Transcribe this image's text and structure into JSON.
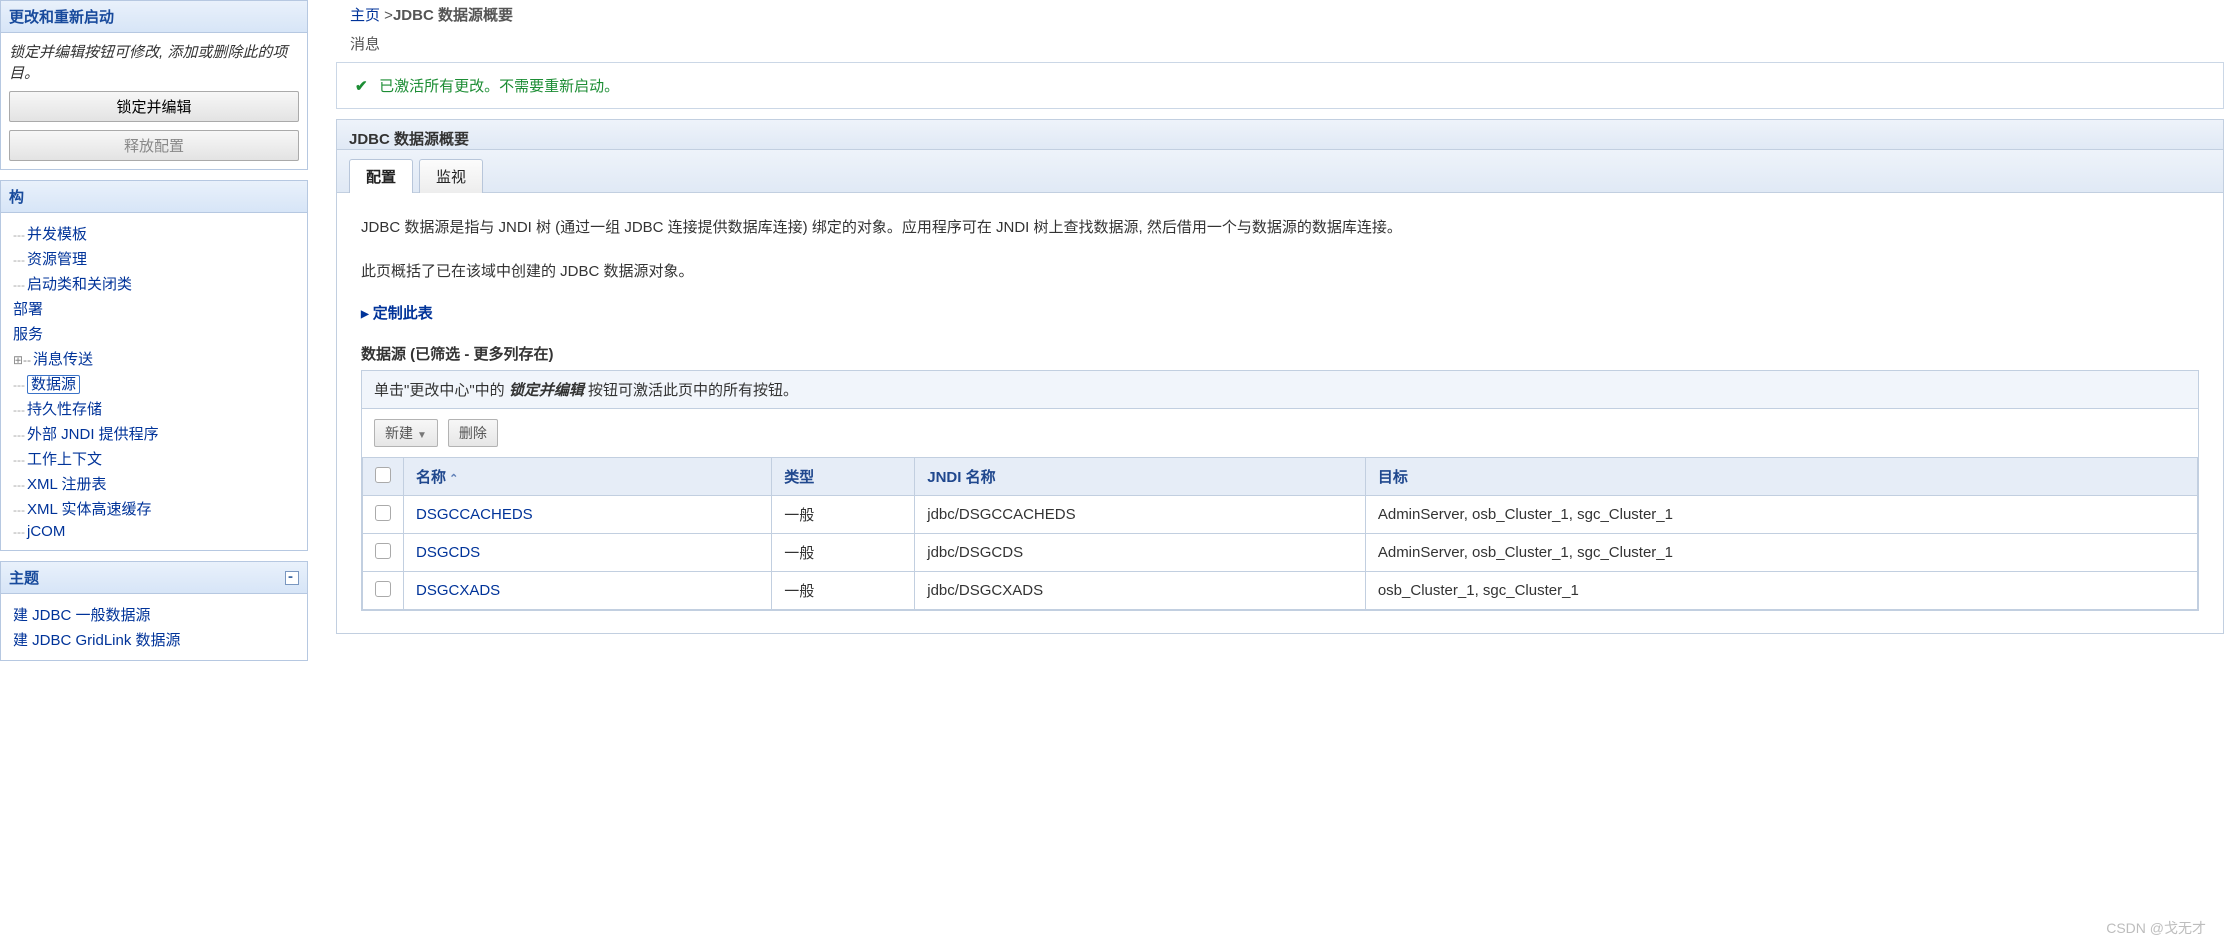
{
  "left": {
    "change_center": {
      "title": "更改和重新启动",
      "note": "锁定并编辑按钮可修改, 添加或删除此的项目。",
      "lock_btn": "锁定并编辑",
      "release_btn": "释放配置"
    },
    "domain_tree": {
      "title": "构",
      "items": [
        {
          "kind": "leaf",
          "label": "并发模板"
        },
        {
          "kind": "leaf",
          "label": "资源管理"
        },
        {
          "kind": "leaf",
          "label": "启动类和关闭类"
        },
        {
          "kind": "rootleaf",
          "label": "部署"
        },
        {
          "kind": "rootleaf",
          "label": "服务"
        },
        {
          "kind": "branch",
          "label": "消息传送"
        },
        {
          "kind": "leaf",
          "label": "数据源",
          "selected": true
        },
        {
          "kind": "leaf",
          "label": "持久性存储"
        },
        {
          "kind": "leaf",
          "label": "外部 JNDI 提供程序"
        },
        {
          "kind": "leaf",
          "label": "工作上下文"
        },
        {
          "kind": "leaf",
          "label": "XML 注册表"
        },
        {
          "kind": "leaf",
          "label": "XML 实体高速缓存"
        },
        {
          "kind": "leaf",
          "label": "jCOM"
        }
      ]
    },
    "topics": {
      "title": "主题",
      "items": [
        "建 JDBC 一般数据源",
        "建 JDBC GridLink 数据源"
      ]
    }
  },
  "breadcrumb": {
    "home": "主页",
    "sep": " >",
    "current": "JDBC 数据源概要"
  },
  "messages": {
    "label": "消息",
    "text": "已激活所有更改。不需要重新启动。"
  },
  "content": {
    "title": "JDBC 数据源概要",
    "tabs": [
      {
        "label": "配置",
        "active": true
      },
      {
        "label": "监视",
        "active": false
      }
    ],
    "para1": "JDBC 数据源是指与 JNDI 树 (通过一组 JDBC 连接提供数据库连接) 绑定的对象。应用程序可在 JNDI 树上查找数据源, 然后借用一个与数据源的数据库连接。",
    "para2": "此页概括了已在该域中创建的 JDBC 数据源对象。",
    "customize": "定制此表",
    "ds_heading": "数据源 (已筛选 - 更多列存在)",
    "help_prefix": "单击\"更改中心\"中的",
    "help_em": "锁定并编辑",
    "help_suffix": "按钮可激活此页中的所有按钮。",
    "new_btn": "新建",
    "delete_btn": "删除",
    "columns": {
      "name": "名称",
      "type": "类型",
      "jndi": "JNDI 名称",
      "target": "目标"
    },
    "rows": [
      {
        "name": "DSGCCACHEDS",
        "type": "一般",
        "jndi": "jdbc/DSGCCACHEDS",
        "target": "AdminServer, osb_Cluster_1, sgc_Cluster_1"
      },
      {
        "name": "DSGCDS",
        "type": "一般",
        "jndi": "jdbc/DSGCDS",
        "target": "AdminServer, osb_Cluster_1, sgc_Cluster_1"
      },
      {
        "name": "DSGCXADS",
        "type": "一般",
        "jndi": "jdbc/DSGCXADS",
        "target": "osb_Cluster_1, sgc_Cluster_1"
      }
    ]
  },
  "watermark": "CSDN @戈无才"
}
